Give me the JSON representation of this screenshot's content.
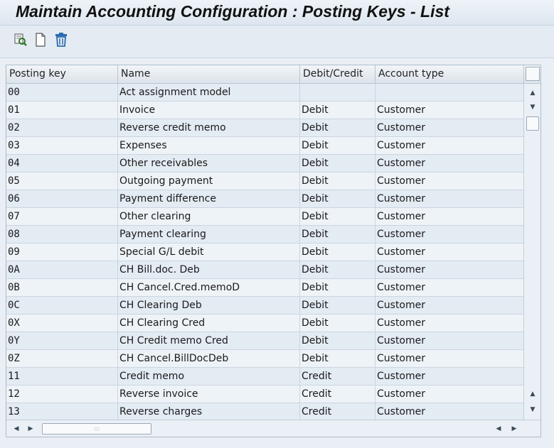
{
  "window": {
    "title": "Maintain Accounting Configuration : Posting Keys - List"
  },
  "toolbar": {
    "buttons": [
      {
        "icon": "details-icon"
      },
      {
        "icon": "new-entry-icon"
      },
      {
        "icon": "delete-icon"
      }
    ]
  },
  "table": {
    "columns": [
      "Posting key",
      "Name",
      "Debit/Credit",
      "Account type"
    ],
    "rows": [
      {
        "key": "00",
        "name": "Act assignment model",
        "dc": "",
        "type": ""
      },
      {
        "key": "01",
        "name": "Invoice",
        "dc": "Debit",
        "type": "Customer"
      },
      {
        "key": "02",
        "name": "Reverse credit memo",
        "dc": "Debit",
        "type": "Customer"
      },
      {
        "key": "03",
        "name": "Expenses",
        "dc": "Debit",
        "type": "Customer"
      },
      {
        "key": "04",
        "name": "Other receivables",
        "dc": "Debit",
        "type": "Customer"
      },
      {
        "key": "05",
        "name": "Outgoing payment",
        "dc": "Debit",
        "type": "Customer"
      },
      {
        "key": "06",
        "name": "Payment difference",
        "dc": "Debit",
        "type": "Customer"
      },
      {
        "key": "07",
        "name": "Other clearing",
        "dc": "Debit",
        "type": "Customer"
      },
      {
        "key": "08",
        "name": "Payment clearing",
        "dc": "Debit",
        "type": "Customer"
      },
      {
        "key": "09",
        "name": "Special G/L debit",
        "dc": "Debit",
        "type": "Customer"
      },
      {
        "key": "0A",
        "name": "CH Bill.doc. Deb",
        "dc": "Debit",
        "type": "Customer"
      },
      {
        "key": "0B",
        "name": "CH Cancel.Cred.memoD",
        "dc": "Debit",
        "type": "Customer"
      },
      {
        "key": "0C",
        "name": "CH Clearing Deb",
        "dc": "Debit",
        "type": "Customer"
      },
      {
        "key": "0X",
        "name": "CH Clearing Cred",
        "dc": "Debit",
        "type": "Customer"
      },
      {
        "key": "0Y",
        "name": "CH Credit memo Cred",
        "dc": "Debit",
        "type": "Customer"
      },
      {
        "key": "0Z",
        "name": "CH Cancel.BillDocDeb",
        "dc": "Debit",
        "type": "Customer"
      },
      {
        "key": "11",
        "name": "Credit memo",
        "dc": "Credit",
        "type": "Customer"
      },
      {
        "key": "12",
        "name": "Reverse invoice",
        "dc": "Credit",
        "type": "Customer"
      },
      {
        "key": "13",
        "name": "Reverse charges",
        "dc": "Credit",
        "type": "Customer"
      }
    ]
  },
  "colors": {
    "row_odd": "#e3ebf3",
    "row_even": "#eef3f8",
    "header": "#dce3ea",
    "accent_icon": "#2a6ab0"
  }
}
